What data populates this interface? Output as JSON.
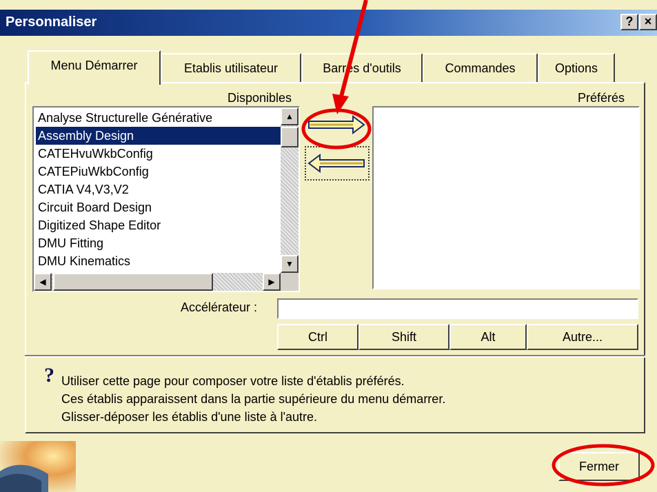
{
  "window": {
    "title": "Personnaliser",
    "help_button": "?",
    "close_button": "×"
  },
  "tabs": [
    {
      "label": "Menu Démarrer"
    },
    {
      "label": "Etablis utilisateur"
    },
    {
      "label": "Barres d'outils"
    },
    {
      "label": "Commandes"
    },
    {
      "label": "Options"
    }
  ],
  "lists": {
    "available_label": "Disponibles",
    "preferred_label": "Préférés",
    "available_items": [
      "Analyse Structurelle Générative",
      "Assembly Design",
      "CATEHvuWkbConfig",
      "CATEPiuWkbConfig",
      "CATIA V4,V3,V2",
      "Circuit Board Design",
      "Digitized Shape Editor",
      "DMU Fitting",
      "DMU Kinematics"
    ],
    "selected_item": "Assembly Design",
    "preferred_items": []
  },
  "accelerator": {
    "label": "Accélérateur :",
    "value": "",
    "buttons": [
      "Ctrl",
      "Shift",
      "Alt",
      "Autre..."
    ]
  },
  "help": {
    "icon": "question-mark-icon",
    "lines": [
      "Utiliser cette page pour composer votre liste d'établis préférés.",
      "Ces établis apparaissent dans la partie supérieure du menu démarrer.",
      "Glisser-déposer les établis d'une liste à l'autre."
    ]
  },
  "footer": {
    "close_label": "Fermer"
  },
  "colors": {
    "annotation": "#e60000",
    "selection": "#0a246a",
    "dialog_bg": "#f4f0c6"
  }
}
